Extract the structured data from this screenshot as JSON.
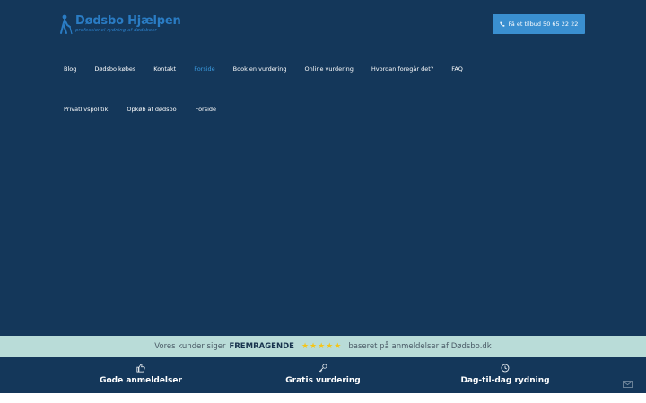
{
  "brand": {
    "name": "Dødsbo Hjælpen",
    "tagline": "professionel rydning af dødsboer"
  },
  "cta": {
    "label": "Få et tilbud 50 65 22 22",
    "icon": "phone-icon"
  },
  "nav": {
    "row1": [
      {
        "label": "Blog"
      },
      {
        "label": "Dødsbo købes"
      },
      {
        "label": "Kontakt"
      },
      {
        "label": "Forside",
        "active": true
      },
      {
        "label": "Book en vurdering"
      },
      {
        "label": "Online vurdering"
      },
      {
        "label": "Hvordan foregår det?"
      },
      {
        "label": "FAQ"
      }
    ],
    "row2": [
      {
        "label": "Privatlivspolitik"
      },
      {
        "label": "Opkøb af dødsbo"
      },
      {
        "label": "Forside"
      }
    ],
    "active_color": "#3a9be0"
  },
  "reviews": {
    "prefix": "Vores kunder siger",
    "rating_word": "FREMRAGENDE",
    "stars": 5,
    "suffix": "baseret på anmeldelser af Dødsbo.dk"
  },
  "features": [
    {
      "icon": "thumbs-up-icon",
      "label": "Gode anmeldelser"
    },
    {
      "icon": "key-icon",
      "label": "Gratis vurdering"
    },
    {
      "icon": "clock-icon",
      "label": "Dag-til-dag rydning"
    }
  ],
  "colors": {
    "hero_bg": "#14375a",
    "accent": "#3a8fd0",
    "review_bar": "#b9dcd8",
    "star": "#f5c518"
  }
}
